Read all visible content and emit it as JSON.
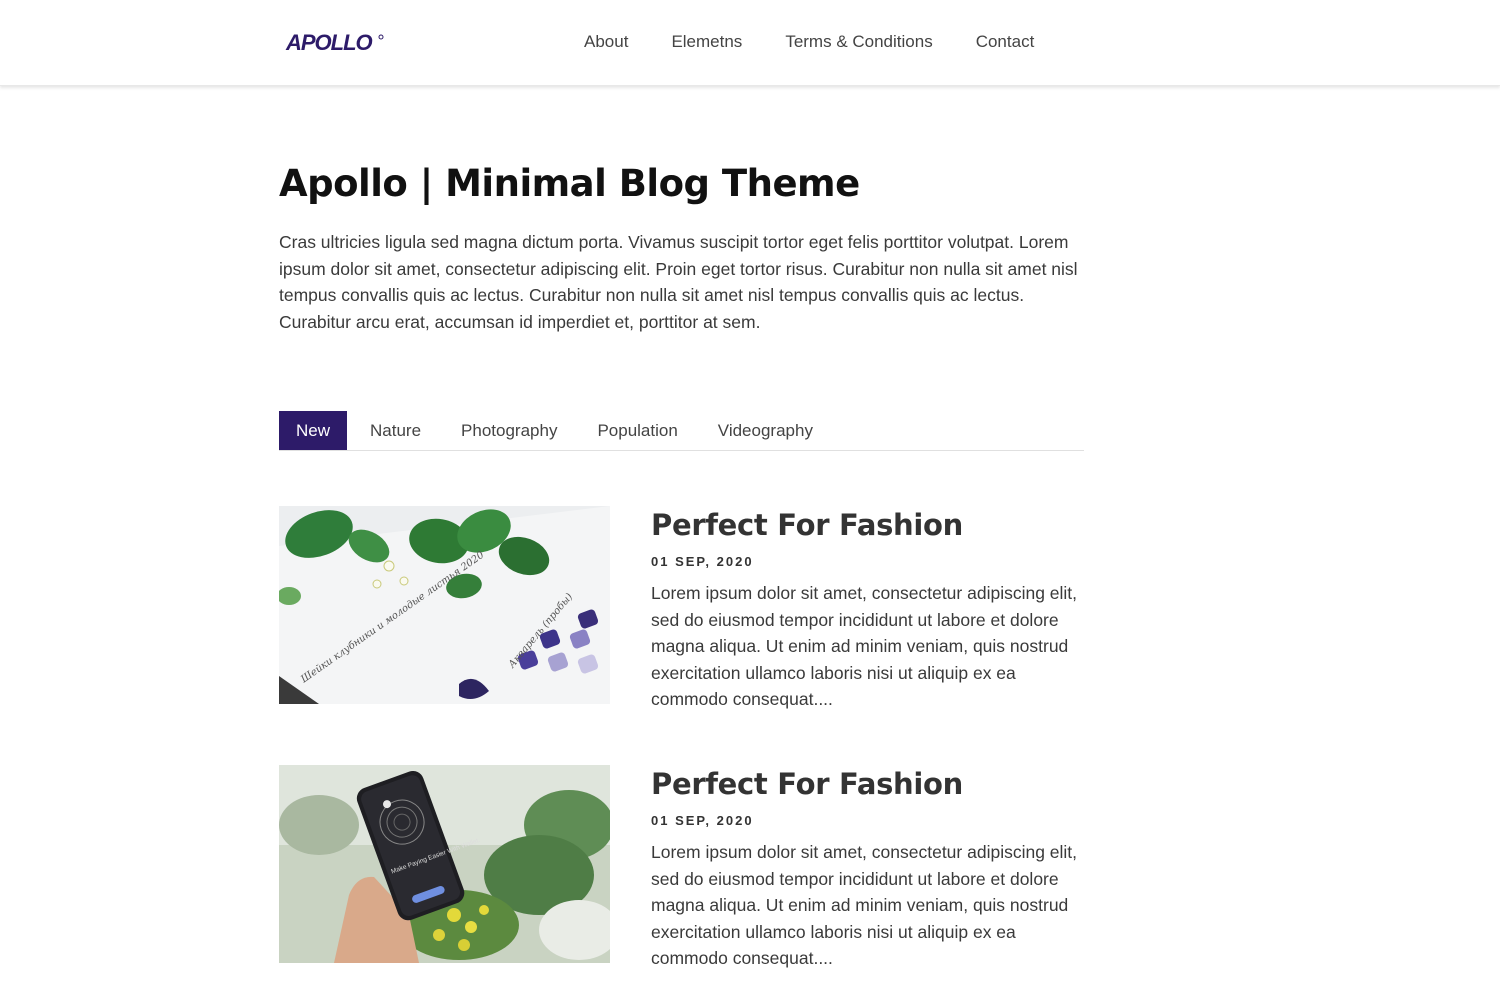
{
  "header": {
    "logo_text": "APOLLO",
    "nav": [
      "About",
      "Elemetns",
      "Terms & Conditions",
      "Contact"
    ]
  },
  "hero": {
    "title": "Apollo | Minimal Blog Theme",
    "description": "Cras ultricies ligula sed magna dictum porta. Vivamus suscipit tortor eget felis porttitor volutpat. Lorem ipsum dolor sit amet, consectetur adipiscing elit. Proin eget tortor risus. Curabitur non nulla sit amet nisl tempus convallis quis ac lectus. Curabitur non nulla sit amet nisl tempus convallis quis ac lectus. Curabitur arcu erat, accumsan id imperdiet et, porttitor at sem."
  },
  "tabs": [
    {
      "label": "New",
      "active": true
    },
    {
      "label": "Nature",
      "active": false
    },
    {
      "label": "Photography",
      "active": false
    },
    {
      "label": "Population",
      "active": false
    },
    {
      "label": "Videography",
      "active": false
    }
  ],
  "posts": [
    {
      "title": "Perfect For Fashion",
      "date": "01 SEP, 2020",
      "excerpt": "Lorem ipsum dolor sit amet, consectetur adipiscing elit, sed do eiusmod tempor incididunt ut labore et dolore magna aliqua. Ut enim ad minim veniam, quis nostrud exercitation ullamco laboris nisi ut aliquip ex ea commodo consequat....",
      "image": "watercolor-leaves-sketch",
      "image_text_1": "Шейки клубники и молодые листья 2020",
      "image_text_2": "Акварель (пробы)"
    },
    {
      "title": "Perfect For Fashion",
      "date": "01 SEP, 2020",
      "excerpt": "Lorem ipsum dolor sit amet, consectetur adipiscing elit, sed do eiusmod tempor incididunt ut labore et dolore magna aliqua. Ut enim ad minim veniam, quis nostrud exercitation ullamco laboris nisi ut aliquip ex ea commodo consequat....",
      "image": "hand-holding-phone-plants",
      "image_text_1": "Make Paying Easier With Wallet."
    }
  ],
  "colors": {
    "brand": "#2d1b69",
    "text": "#333333",
    "tab_active_text": "#ffffff"
  }
}
